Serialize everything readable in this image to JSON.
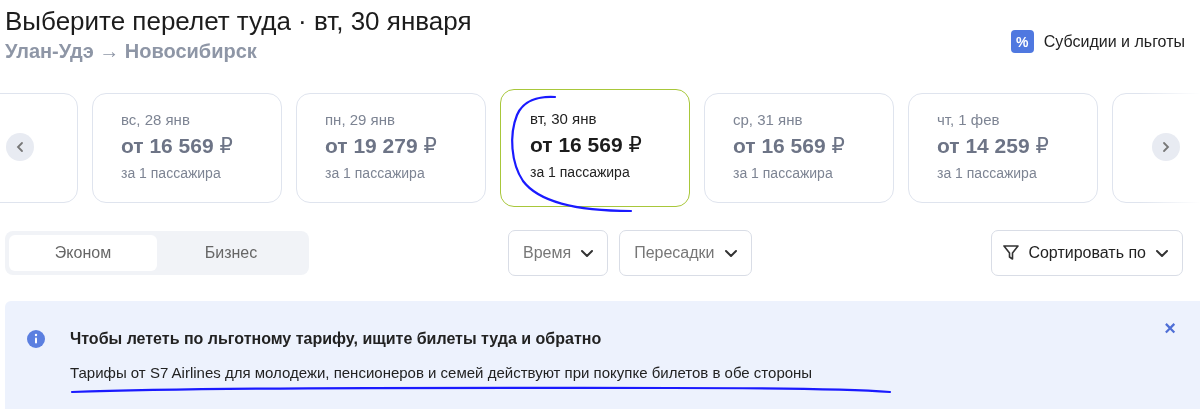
{
  "header": {
    "title": "Выберите перелет туда · вт, 30 января",
    "route": "Улан-Удэ → Новосибирск",
    "subsidies_link": "Субсидии и льготы",
    "subsidies_icon": "%"
  },
  "date_cards": [
    {
      "date": "вс, 28 янв",
      "price": "от 16 569",
      "currency": "₽",
      "note": "за 1 пассажира",
      "selected": false
    },
    {
      "date": "пн, 29 янв",
      "price": "от 19 279",
      "currency": "₽",
      "note": "за 1 пассажира",
      "selected": false
    },
    {
      "date": "вт, 30 янв",
      "price": "от 16 569",
      "currency": "₽",
      "note": "за 1 пассажира",
      "selected": true
    },
    {
      "date": "ср, 31 янв",
      "price": "от 16 569",
      "currency": "₽",
      "note": "за 1 пассажира",
      "selected": false
    },
    {
      "date": "чт, 1 фев",
      "price": "от 14 259",
      "currency": "₽",
      "note": "за 1 пассажира",
      "selected": false
    }
  ],
  "cabin_tabs": [
    {
      "label": "Эконом",
      "selected": true
    },
    {
      "label": "Бизнес",
      "selected": false
    }
  ],
  "filters": [
    {
      "label": "Время"
    },
    {
      "label": "Пересадки"
    }
  ],
  "sort": {
    "label": "Сортировать по"
  },
  "banner": {
    "title": "Чтобы лететь по льготному тарифу, ищите билеты туда и обратно",
    "text": "Тарифы от S7 Airlines для молодежи, пенсионеров и семей действуют при покупке билетов в обе стороны",
    "close": "×"
  },
  "annotations": [
    {
      "kind": "loop"
    },
    {
      "kind": "underline"
    }
  ]
}
